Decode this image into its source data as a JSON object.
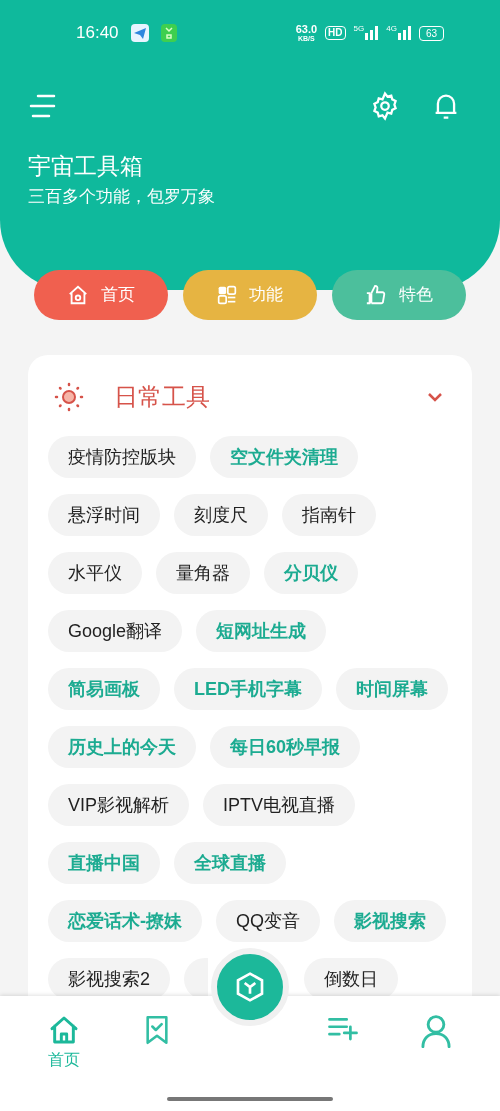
{
  "status_bar": {
    "time": "16:40",
    "speed": "63.0",
    "speed_unit": "KB/S",
    "hd": "HD",
    "net1": "5G",
    "net2": "4G",
    "battery": "63"
  },
  "header": {
    "title": "宇宙工具箱",
    "subtitle": "三百多个功能，包罗万象"
  },
  "tabs": [
    {
      "label": "首页",
      "kind": "home",
      "color": "#f0604f"
    },
    {
      "label": "功能",
      "kind": "grid",
      "color": "#e6b442"
    },
    {
      "label": "特色",
      "kind": "like",
      "color": "#4cbf9c"
    }
  ],
  "section": {
    "title": "日常工具",
    "expanded": true
  },
  "tools": [
    {
      "label": "疫情防控版块",
      "highlighted": false
    },
    {
      "label": "空文件夹清理",
      "highlighted": true
    },
    {
      "label": "悬浮时间",
      "highlighted": false
    },
    {
      "label": "刻度尺",
      "highlighted": false
    },
    {
      "label": "指南针",
      "highlighted": false
    },
    {
      "label": "水平仪",
      "highlighted": false
    },
    {
      "label": "量角器",
      "highlighted": false
    },
    {
      "label": "分贝仪",
      "highlighted": true
    },
    {
      "label": "Google翻译",
      "highlighted": false
    },
    {
      "label": "短网址生成",
      "highlighted": true
    },
    {
      "label": "简易画板",
      "highlighted": true
    },
    {
      "label": "LED手机字幕",
      "highlighted": true
    },
    {
      "label": "时间屏幕",
      "highlighted": true
    },
    {
      "label": "历史上的今天",
      "highlighted": true
    },
    {
      "label": "每日60秒早报",
      "highlighted": true
    },
    {
      "label": "VIP影视解析",
      "highlighted": false
    },
    {
      "label": "IPTV电视直播",
      "highlighted": false
    },
    {
      "label": "直播中国",
      "highlighted": true
    },
    {
      "label": "全球直播",
      "highlighted": true
    },
    {
      "label": "恋爱话术-撩妹",
      "highlighted": true
    },
    {
      "label": "QQ变音",
      "highlighted": false
    },
    {
      "label": "影视搜索",
      "highlighted": true
    },
    {
      "label": "影视搜索2",
      "highlighted": false
    },
    {
      "kind": "covered",
      "highlighted": false
    },
    {
      "label": "倒数日",
      "highlighted": false
    }
  ],
  "bottom_nav": [
    {
      "kind": "home",
      "label": "首页",
      "selected": true
    },
    {
      "kind": "bookmark",
      "selected": false
    },
    {
      "kind": "fab",
      "selected": false
    },
    {
      "kind": "playlist",
      "selected": false
    },
    {
      "kind": "user",
      "selected": false
    }
  ]
}
